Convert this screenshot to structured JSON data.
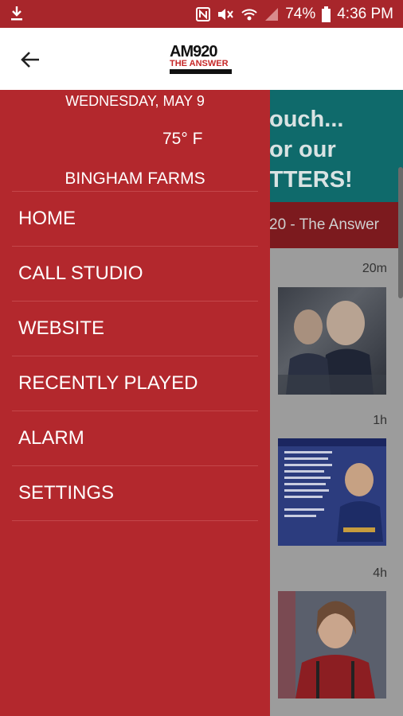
{
  "status_bar": {
    "battery": "74%",
    "time": "4:36 PM",
    "icons": [
      "download-icon",
      "nfc-icon",
      "mute-icon",
      "wifi-icon",
      "signal-icon",
      "battery-icon"
    ]
  },
  "header": {
    "logo_line1": "AM920",
    "logo_line2": "THE ANSWER",
    "back_icon": "arrow-back-icon"
  },
  "drawer": {
    "date": "WEDNESDAY, MAY 9",
    "temperature": "75° F",
    "city": "BINGHAM FARMS",
    "items": [
      {
        "label": "HOME"
      },
      {
        "label": "CALL STUDIO"
      },
      {
        "label": "WEBSITE"
      },
      {
        "label": "RECENTLY PLAYED"
      },
      {
        "label": "ALARM"
      },
      {
        "label": "SETTINGS"
      }
    ]
  },
  "background": {
    "banner_lines": [
      "ouch...",
      "or our",
      "TTERS!"
    ],
    "station_bar": "20 - The Answer",
    "posts": [
      {
        "time": "20m"
      },
      {
        "time": "1h"
      },
      {
        "time": "4h"
      }
    ]
  },
  "colors": {
    "brand_red": "#b3282d",
    "status_red": "#a8262b",
    "teal": "#0f6a6b"
  }
}
